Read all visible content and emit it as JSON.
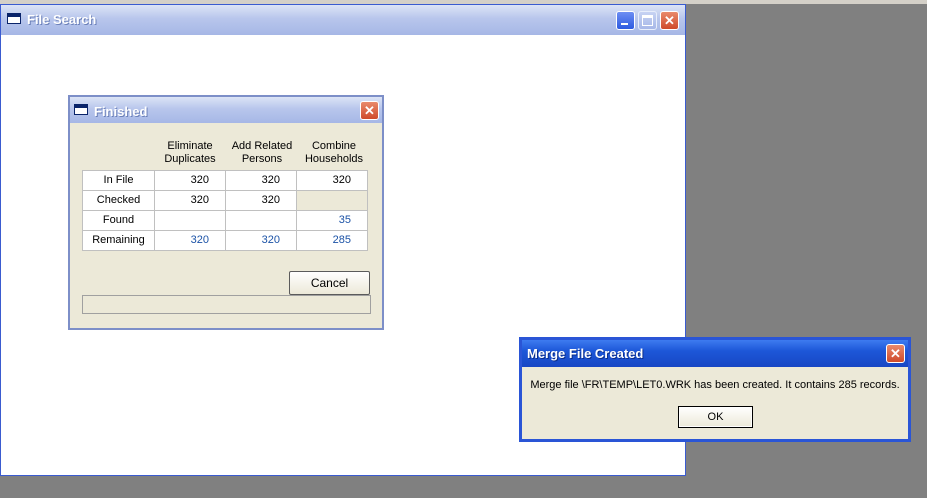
{
  "main_window": {
    "title": "File Search",
    "icon": "window-icon"
  },
  "finished_dialog": {
    "title": "Finished",
    "columns": [
      {
        "line1": "Eliminate",
        "line2": "Duplicates"
      },
      {
        "line1": "Add Related",
        "line2": "Persons"
      },
      {
        "line1": "Combine",
        "line2": "Households"
      }
    ],
    "rows": [
      {
        "label": "In File",
        "values": [
          "320",
          "320",
          "320"
        ]
      },
      {
        "label": "Checked",
        "values": [
          "320",
          "320",
          ""
        ]
      },
      {
        "label": "Found",
        "values": [
          "",
          "",
          "35"
        ]
      },
      {
        "label": "Remaining",
        "values": [
          "320",
          "320",
          "285"
        ]
      }
    ],
    "cancel_label": "Cancel",
    "status_text": ""
  },
  "merge_dialog": {
    "title": "Merge File Created",
    "message": "Merge file \\FR\\TEMP\\LET0.WRK has been created.  It contains 285 records.",
    "ok_label": "OK"
  },
  "colors": {
    "value_blue": "#1b52a6",
    "xp_title_blue": "#1d57d8",
    "dialog_bg": "#ece9d8"
  }
}
